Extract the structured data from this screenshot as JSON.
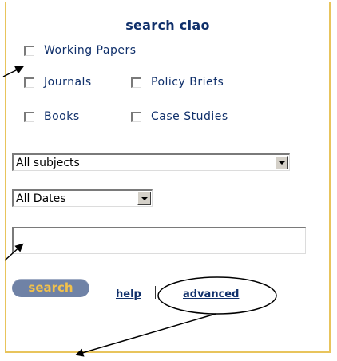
{
  "panel": {
    "title": "search ciao",
    "checkboxes": [
      {
        "label": "Working Papers",
        "checked": false
      },
      {
        "label": "Journals",
        "checked": false
      },
      {
        "label": "Policy Briefs",
        "checked": false
      },
      {
        "label": "Books",
        "checked": false
      },
      {
        "label": "Case Studies",
        "checked": false
      }
    ],
    "subjects_select": {
      "selected": "All subjects"
    },
    "dates_select": {
      "selected": "All Dates"
    },
    "query_input": {
      "value": "",
      "placeholder": ""
    },
    "search_button": "search",
    "help_link": "help",
    "advanced_link": "advanced"
  },
  "colors": {
    "border": "#e8c45c",
    "text": "#10306b",
    "button_bg": "#6f82a6",
    "button_text": "#f2c14a"
  },
  "annotations": {
    "icons": [
      "arrow-icon",
      "arrow-icon",
      "arrow-icon",
      "ellipse-icon"
    ]
  }
}
